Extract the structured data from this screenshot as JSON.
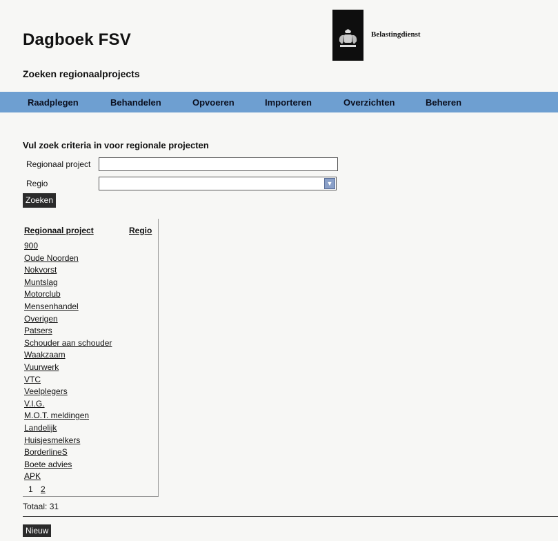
{
  "header": {
    "app_title": "Dagboek FSV",
    "org_name": "Belastingdienst",
    "page_subtitle": "Zoeken regionaalprojects"
  },
  "nav": {
    "items": [
      "Raadplegen",
      "Behandelen",
      "Opvoeren",
      "Importeren",
      "Overzichten",
      "Beheren"
    ]
  },
  "search": {
    "section_title": "Vul zoek criteria in voor regionale projecten",
    "project_label": "Regionaal project",
    "project_value": "",
    "region_label": "Regio",
    "region_value": "",
    "submit_label": "Zoeken"
  },
  "results": {
    "columns": [
      "Regionaal project",
      "Regio"
    ],
    "rows": [
      "900",
      "Oude Noorden",
      "Nokvorst",
      "Muntslag",
      "Motorclub",
      "Mensenhandel",
      "Overigen",
      "Patsers",
      "Schouder aan schouder",
      "Waakzaam",
      "Vuurwerk",
      "VTC",
      "Veelplegers",
      "V.I.G.",
      "M.O.T. meldingen",
      "Landelijk",
      "Huisjesmelkers",
      "BorderlineS",
      "Boete advies",
      "APK"
    ],
    "pages": [
      "1",
      "2"
    ],
    "current_page": "1",
    "total": "Totaal: 31"
  },
  "footer": {
    "new_label": "Nieuw"
  },
  "colors": {
    "nav_background": "#6e9fd1",
    "button_background": "#2b2b2b"
  }
}
